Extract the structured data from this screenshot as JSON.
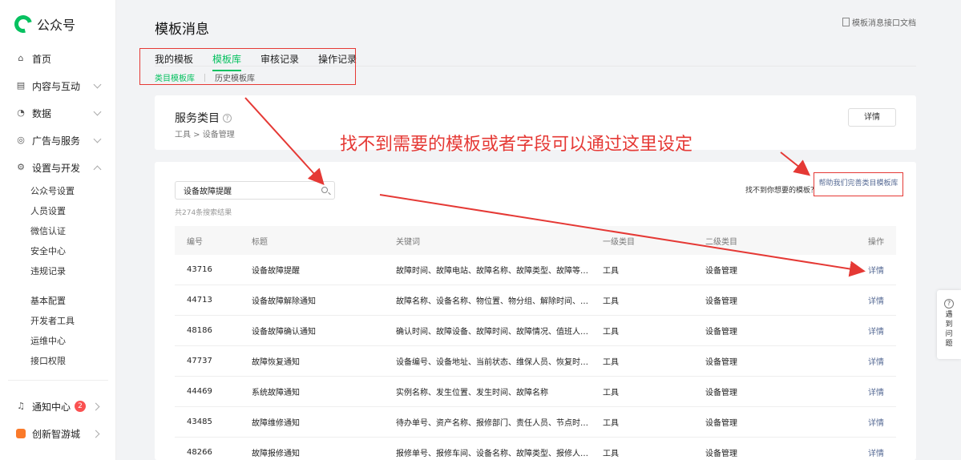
{
  "logo": {
    "text": "公众号"
  },
  "sidebar": {
    "items": [
      {
        "label": "首页",
        "icon": "home-icon"
      },
      {
        "label": "内容与互动",
        "icon": "document-icon"
      },
      {
        "label": "数据",
        "icon": "chart-icon"
      },
      {
        "label": "广告与服务",
        "icon": "compass-icon"
      },
      {
        "label": "设置与开发",
        "icon": "gear-icon"
      }
    ],
    "sub_items_a": [
      "公众号设置",
      "人员设置",
      "微信认证",
      "安全中心",
      "违规记录"
    ],
    "sub_items_b": [
      "基本配置",
      "开发者工具",
      "运维中心",
      "接口权限"
    ],
    "bottom": [
      {
        "label": "通知中心",
        "badge": "2",
        "icon": "bell-icon"
      },
      {
        "label": "创新智游城",
        "icon": "game-icon"
      }
    ]
  },
  "header": {
    "title": "模板消息",
    "doc_link": "模板消息接口文档"
  },
  "tabs": [
    "我的模板",
    "模板库",
    "审核记录",
    "操作记录"
  ],
  "subtabs": [
    "类目模板库",
    "历史模板库"
  ],
  "service": {
    "title": "服务类目",
    "breadcrumb": "工具 > 设备管理",
    "detail_button": "详情"
  },
  "search": {
    "value": "设备故障提醒"
  },
  "result_count": "共274条搜索结果",
  "notfound_text": "找不到你想要的模板？",
  "help_link": "帮助我们完善类目模板库",
  "annotation": "找不到需要的模板或者字段可以通过这里设定",
  "table": {
    "headers": [
      "编号",
      "标题",
      "关键词",
      "一级类目",
      "二级类目",
      "操作"
    ],
    "rows": [
      [
        "43716",
        "设备故障提醒",
        "故障时间、故障电站、故障名称、故障类型、故障等级、电…",
        "工具",
        "设备管理",
        "详情"
      ],
      [
        "44713",
        "设备故障解除通知",
        "故障名称、设备名称、物位置、物分组、解除时间、消警时…",
        "工具",
        "设备管理",
        "详情"
      ],
      [
        "48186",
        "设备故障确认通知",
        "确认时间、故障设备、故障时间、故障情况、值班人员、设…",
        "工具",
        "设备管理",
        "详情"
      ],
      [
        "47737",
        "故障恢复通知",
        "设备编号、设备地址、当前状态、维保人员、恢复时间、设…",
        "工具",
        "设备管理",
        "详情"
      ],
      [
        "44469",
        "系统故障通知",
        "实例名称、发生位置、发生时间、故障名称",
        "工具",
        "设备管理",
        "详情"
      ],
      [
        "43485",
        "故障维修通知",
        "待办单号、资产名称、报修部门、责任人员、节点时间、故…",
        "工具",
        "设备管理",
        "详情"
      ],
      [
        "48266",
        "故障报修通知",
        "报修单号、报修车间、设备名称、故障类型、报修人、报修…",
        "工具",
        "设备管理",
        "详情"
      ]
    ]
  },
  "float_help": {
    "text": "遇到问题"
  },
  "colors": {
    "accent": "#07c160",
    "annotation": "#e53935",
    "link": "#576b95"
  }
}
